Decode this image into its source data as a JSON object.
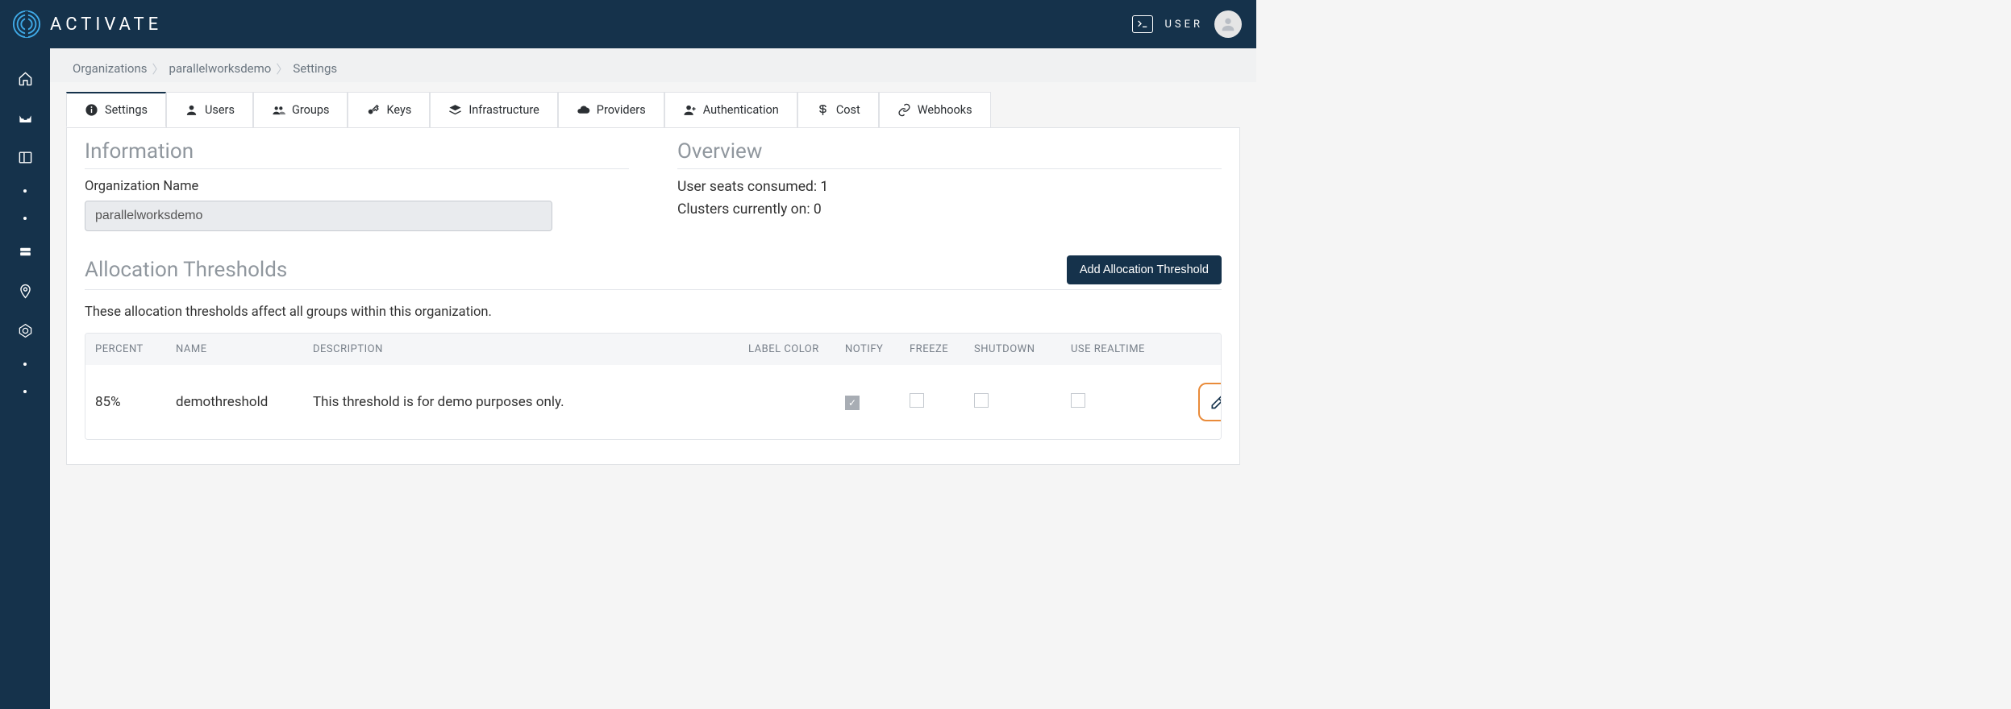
{
  "header": {
    "brand_name": "ACTIVATE",
    "user_label": "USER"
  },
  "breadcrumb": {
    "items": [
      "Organizations",
      "parallelworksdemo",
      "Settings"
    ]
  },
  "tabs": [
    {
      "label": "Settings",
      "icon": "info-icon",
      "active": true
    },
    {
      "label": "Users",
      "icon": "user-icon"
    },
    {
      "label": "Groups",
      "icon": "group-icon"
    },
    {
      "label": "Keys",
      "icon": "key-icon"
    },
    {
      "label": "Infrastructure",
      "icon": "layers-icon"
    },
    {
      "label": "Providers",
      "icon": "cloud-icon"
    },
    {
      "label": "Authentication",
      "icon": "person-plus-icon"
    },
    {
      "label": "Cost",
      "icon": "dollar-icon"
    },
    {
      "label": "Webhooks",
      "icon": "link-icon"
    }
  ],
  "information": {
    "title": "Information",
    "org_name_label": "Organization Name",
    "org_name_value": "parallelworksdemo"
  },
  "overview": {
    "title": "Overview",
    "seats_text": "User seats consumed: 1",
    "clusters_text": "Clusters currently on: 0"
  },
  "allocation": {
    "title": "Allocation Thresholds",
    "add_button": "Add Allocation Threshold",
    "description": "These allocation thresholds affect all groups within this organization.",
    "columns": {
      "percent": "PERCENT",
      "name": "NAME",
      "description": "DESCRIPTION",
      "label_color": "LABEL COLOR",
      "notify": "NOTIFY",
      "freeze": "FREEZE",
      "shutdown": "SHUTDOWN",
      "use_realtime": "USE REALTIME"
    },
    "rows": [
      {
        "percent": "85%",
        "name": "demothreshold",
        "description": "This threshold is for demo purposes only.",
        "label_color": "#b41cd6",
        "notify": true,
        "freeze": false,
        "shutdown": false,
        "use_realtime": false
      }
    ]
  }
}
